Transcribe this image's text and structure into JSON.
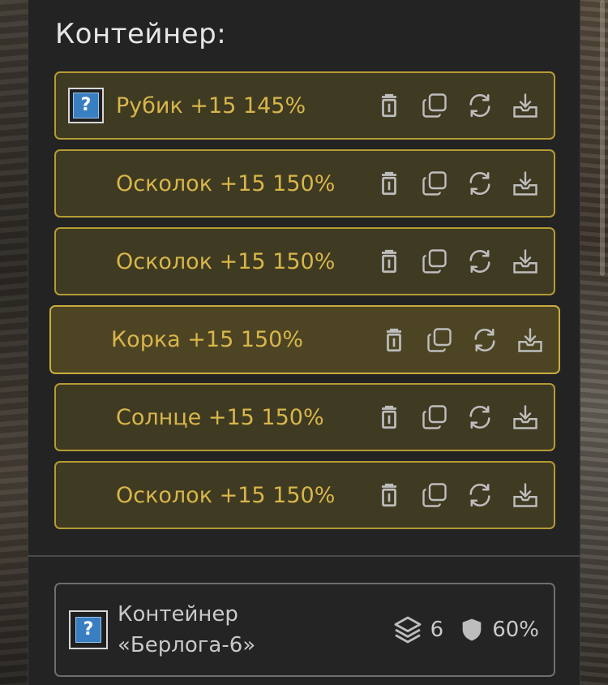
{
  "panel": {
    "title": "Контейнер:"
  },
  "items": [
    {
      "label": "Рубик +15 145%",
      "has_icon": true
    },
    {
      "label": "Осколок +15 150%",
      "has_icon": false
    },
    {
      "label": "Осколок +15 150%",
      "has_icon": false
    },
    {
      "label": "Корка +15 150%",
      "has_icon": false,
      "active": true
    },
    {
      "label": "Солнце +15 150%",
      "has_icon": false
    },
    {
      "label": "Осколок +15 150%",
      "has_icon": false
    }
  ],
  "icons": {
    "placeholder": "?",
    "actions": [
      "trash-icon",
      "copy-icon",
      "swap-icon",
      "download-icon"
    ],
    "stats": [
      "layers-icon",
      "shield-icon"
    ]
  },
  "container_card": {
    "name_line1": "Контейнер",
    "name_line2": "«Берлога-6»",
    "slots": "6",
    "protection": "60%"
  },
  "colors": {
    "item_text": "#d8b64a",
    "item_border": "#b49b34",
    "item_bg": "#3f3a22",
    "icon_gray": "#bdbdbd"
  }
}
